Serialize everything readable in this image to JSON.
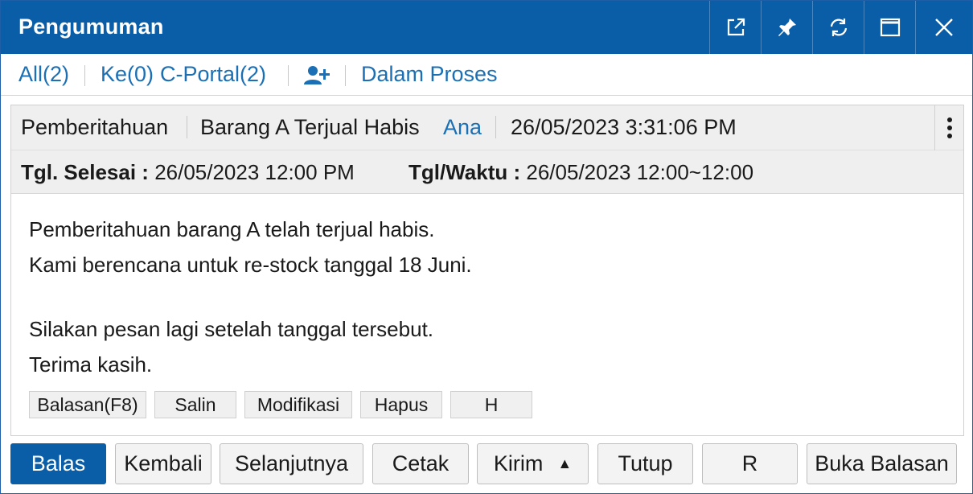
{
  "window": {
    "title": "Pengumuman"
  },
  "titlebar_icons": [
    "popout-icon",
    "pin-icon",
    "refresh-icon",
    "maximize-icon",
    "close-icon"
  ],
  "filters": {
    "all": "All(2)",
    "ke": "Ke(0)",
    "cportal": "C-Portal(2)",
    "add_user_icon": "add-user-icon",
    "status": "Dalam Proses"
  },
  "message": {
    "category": "Pemberitahuan",
    "subject": "Barang A Terjual Habis",
    "sender": "Ana",
    "datetime": "26/05/2023 3:31:06 PM",
    "end_label": "Tgl. Selesai :",
    "end_value": "26/05/2023 12:00 PM",
    "time_label": "Tgl/Waktu :",
    "time_value": "26/05/2023 12:00~12:00",
    "lines": [
      "Pemberitahuan barang A telah terjual habis.",
      "Kami berencana untuk re-stock tanggal 18 Juni.",
      "Silakan pesan lagi setelah tanggal tersebut.",
      "Terima kasih."
    ],
    "actions": [
      "Balasan(F8)",
      "Salin",
      "Modifikasi",
      "Hapus",
      "H"
    ]
  },
  "bottom_actions": {
    "reply": "Balas",
    "back": "Kembali",
    "next": "Selanjutnya",
    "print": "Cetak",
    "send": "Kirim",
    "close": "Tutup",
    "r": "R",
    "open_reply": "Buka Balasan"
  },
  "colors": {
    "accent": "#0a5ea8",
    "link": "#1a6fb5",
    "header_bg": "#efefef"
  }
}
